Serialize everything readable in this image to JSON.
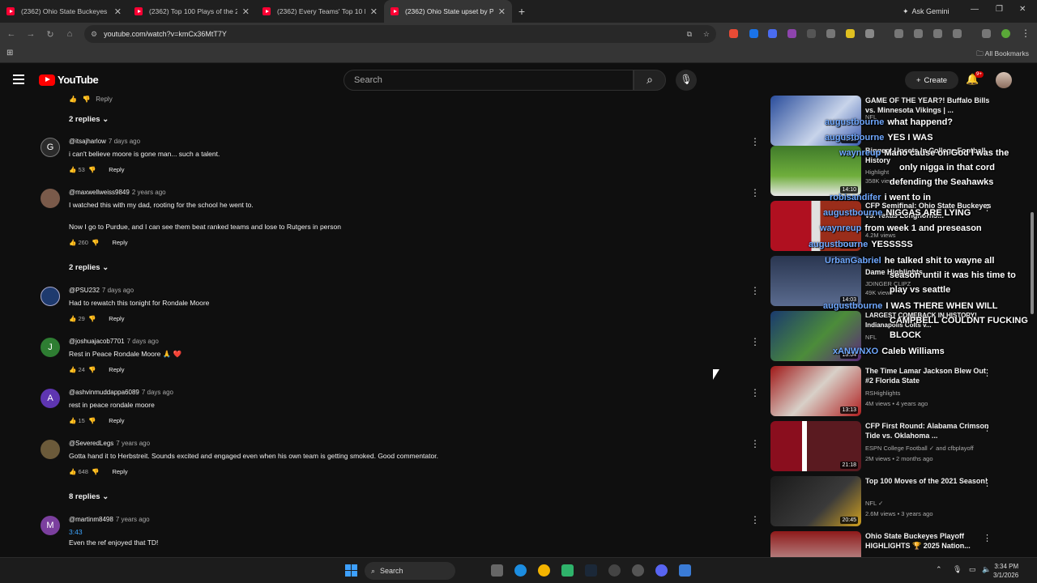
{
  "browser": {
    "tabs": [
      {
        "title": "(2362) Ohio State Buckeyes Pla..."
      },
      {
        "title": "(2362) Top 100 Plays of the 202..."
      },
      {
        "title": "(2362) Every Teams' Top 10 Pla..."
      },
      {
        "title": "(2362) Ohio State upset by Puro..."
      }
    ],
    "ask_gemini": "Ask Gemini",
    "url": "youtube.com/watch?v=kmCx36MtT7Y",
    "all_bookmarks": "All Bookmarks"
  },
  "youtube": {
    "logo_text": "YouTube",
    "search_placeholder": "Search",
    "create_label": "Create",
    "notif_count": "9+"
  },
  "comments": {
    "top_replies": "2 replies",
    "items": [
      {
        "handle": "@itsajharlow",
        "time": "7 days ago",
        "text": "i can't believe moore is gone man... such a talent.",
        "likes": "53",
        "reply": "Reply",
        "avatar_letter": "G",
        "avatar_color": "#2b2b2b"
      },
      {
        "handle": "@maxwellweiss9849",
        "time": "2 years ago",
        "text": "I watched this with my dad, rooting for the school he went to.",
        "text2": "Now I go to Purdue, and I can see them beat ranked teams and lose to Rutgers in person",
        "likes": "260",
        "reply": "Reply",
        "replies": "2 replies",
        "avatar_letter": "",
        "avatar_color": "#7a5a4a"
      },
      {
        "handle": "@PSU232",
        "time": "7 days ago",
        "text": "Had to rewatch this tonight for Rondale Moore",
        "likes": "29",
        "reply": "Reply",
        "avatar_letter": "",
        "avatar_color": "#1e3a6e"
      },
      {
        "handle": "@joshuajacob7701",
        "time": "7 days ago",
        "text": "Rest in Peace Rondale Moore 🙏 ❤️",
        "likes": "24",
        "reply": "Reply",
        "avatar_letter": "J",
        "avatar_color": "#2e7d32"
      },
      {
        "handle": "@ashvinmuddappa6089",
        "time": "7 days ago",
        "text": "rest in peace rondale moore",
        "likes": "15",
        "reply": "Reply",
        "avatar_letter": "A",
        "avatar_color": "#5e35b1"
      },
      {
        "handle": "@SeveredLegs",
        "time": "7 years ago",
        "text": "Gotta hand it to Herbstreit.  Sounds excited and engaged even when his own team is getting smoked.  Good commentator.",
        "likes": "648",
        "reply": "Reply",
        "replies": "8 replies",
        "avatar_letter": "",
        "avatar_color": "#6b5a3a"
      },
      {
        "handle": "@martinm8498",
        "time": "7 years ago",
        "timestamp_link": "3:43",
        "text": "Even the ref enjoyed that TD!",
        "avatar_letter": "M",
        "avatar_color": "#7b3f9e"
      }
    ]
  },
  "sidebar": {
    "videos": [
      {
        "title": "GAME OF THE YEAR?! Buffalo Bills vs. Minnesota Vikings | ...",
        "channel": "NFL",
        "meta": "",
        "duration": "20:11",
        "thumb_bg": "linear-gradient(135deg,#2a4d9c,#c8d4ea 60%,#3a5bb0)"
      },
      {
        "title": "Biggest Upsets In College Football History",
        "channel": "Highlight",
        "meta": "358K views",
        "duration": "14:10",
        "thumb_bg": "linear-gradient(#3f7a2a,#6fae3c 60%,#e8e8e8)"
      },
      {
        "title": "CFP Semifinal: Ohio State Buckeyes vs. Texas Longhorns...",
        "channel": "",
        "meta": "4.2M views",
        "duration": "21:10",
        "thumb_bg": "linear-gradient(90deg,#b01020 45%,#e0e0e0 45%,#e0e0e0 55%,#9a2d1a 55%)"
      },
      {
        "title": "Dame Highlights",
        "channel": "JDINGER CLIPZ",
        "meta": "49K views",
        "duration": "14:03",
        "thumb_bg": "linear-gradient(#2a3650,#5a6b8f)"
      },
      {
        "title": "LARGEST COMEBACK IN HISTORY! Indianapolis Colts v...",
        "channel": "NFL",
        "meta": "",
        "duration": "18:04",
        "thumb_bg": "linear-gradient(135deg,#1a3a6e,#4c8c3a 55%,#5b2a7a)"
      },
      {
        "title": "The Time Lamar Jackson Blew Out #2 Florida State",
        "channel": "RSHighlights",
        "meta": "4M views • 4 years ago",
        "duration": "13:13",
        "thumb_bg": "linear-gradient(135deg,#a01818,#d8d0c8 50%,#b02020)"
      },
      {
        "title": "CFP First Round: Alabama Crimson Tide vs. Oklahoma ...",
        "channel": "ESPN College Football ✓ and cfbplayoff",
        "meta": "2M views • 2 months ago",
        "duration": "21:18",
        "thumb_bg": "linear-gradient(90deg,#8a0e1e 35%,#ffffff 35%,#ffffff 40%,#5a1a20 40%)"
      },
      {
        "title": "Top 100 Moves of the 2021 Season!",
        "channel": "NFL ✓",
        "meta": "2.6M views • 3 years ago",
        "duration": "20:45",
        "thumb_bg": "linear-gradient(135deg,#1a1a1a,#3a3a3a 60%,#d0a020)"
      },
      {
        "title": "Ohio State Buckeyes Playoff HIGHLIGHTS 🏆 2025 Nation...",
        "channel": "",
        "meta": "",
        "duration": "",
        "thumb_bg": "linear-gradient(#8e1a1a,#d4d4d4)"
      }
    ]
  },
  "live_chat_overlay": [
    {
      "user": "augustbourne",
      "msg": "what happend?"
    },
    {
      "user": "augustbourne",
      "msg": "YES I WAS"
    },
    {
      "user": "waynreup",
      "msg": "Mano cause on God I was the"
    },
    {
      "user": "",
      "msg": "only nigga in that cord"
    },
    {
      "user": "",
      "msg": "defending the Seahawks"
    },
    {
      "user": "robisandifer",
      "msg": "i went to in"
    },
    {
      "user": "augustbourne",
      "msg": "NIGGAS ARE LYING"
    },
    {
      "user": "waynreup",
      "msg": "from week 1 and preseason"
    },
    {
      "user": "augustbourne",
      "msg": "YESSSSS"
    },
    {
      "user": "UrbanGabriel",
      "msg": "he talked shit to wayne all"
    },
    {
      "user": "",
      "msg": "season until it was his time to"
    },
    {
      "user": "",
      "msg": "play vs seattle"
    },
    {
      "user": "augustbourne",
      "msg": "I WAS THERE WHEN WILL"
    },
    {
      "user": "",
      "msg": "CAMPBELL COULDNT FUCKING"
    },
    {
      "user": "",
      "msg": "BLOCK"
    },
    {
      "user": "xANWNXO",
      "msg": "Caleb Williams"
    }
  ],
  "taskbar": {
    "search_label": "Search",
    "time": "3:34 PM",
    "date": "3/1/2026"
  }
}
